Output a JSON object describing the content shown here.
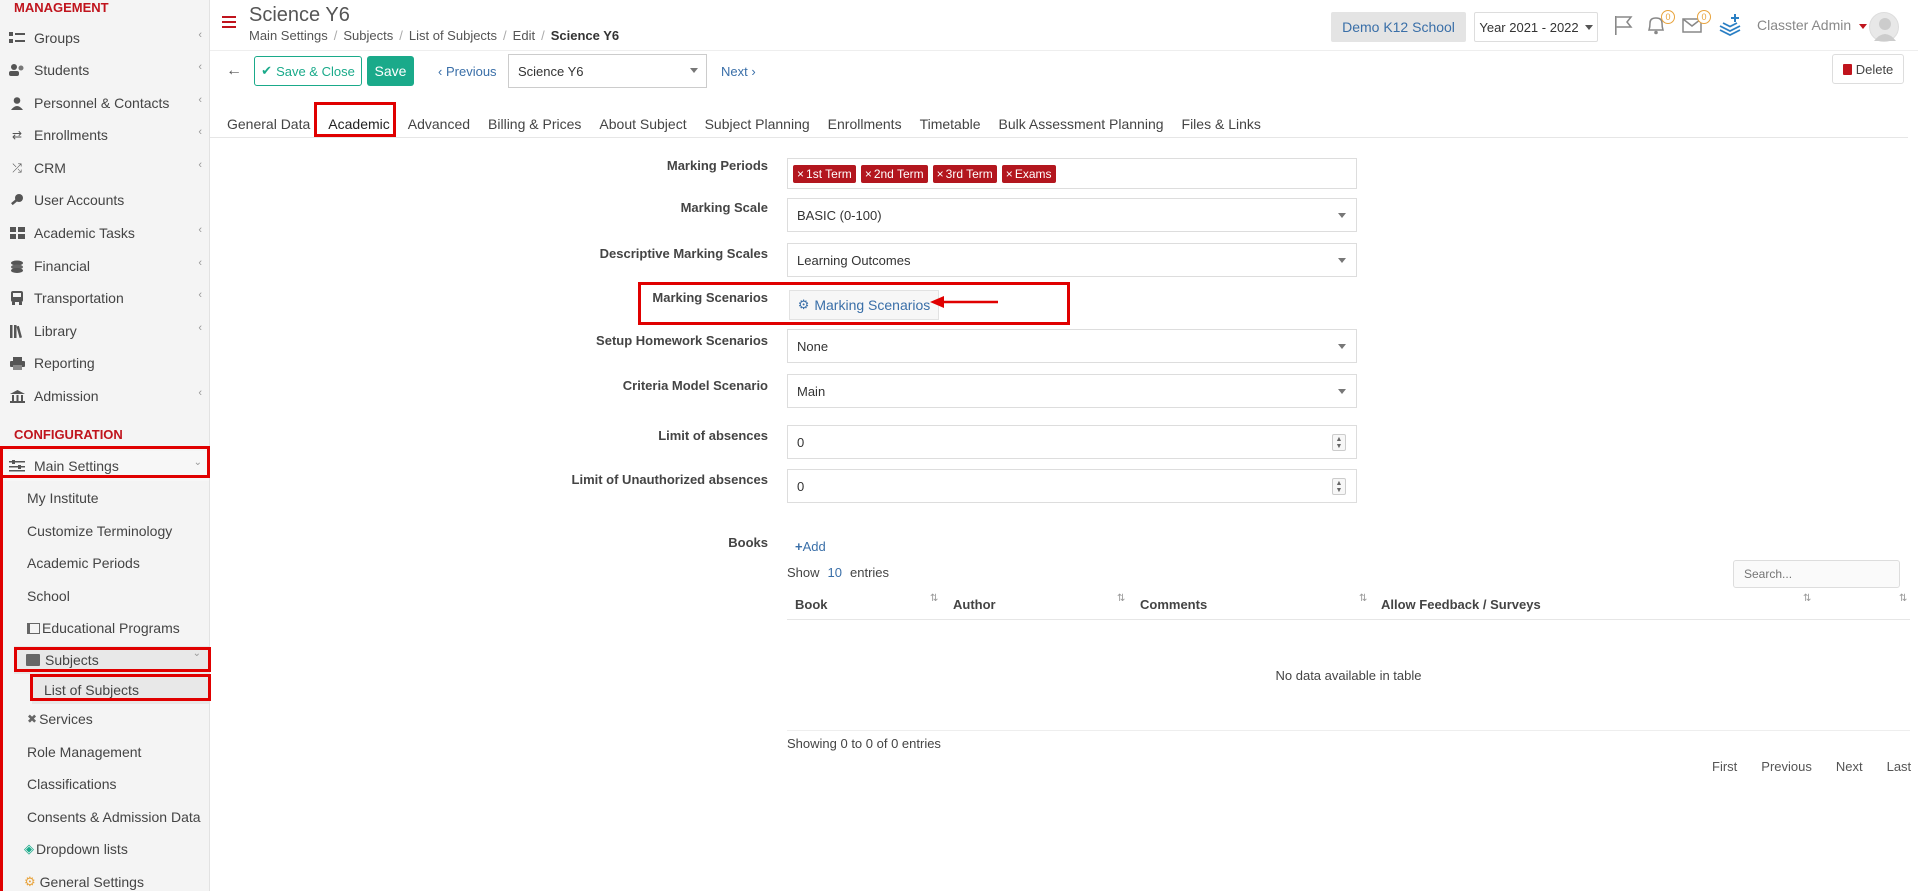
{
  "sidebar": {
    "management_heading": "MANAGEMENT",
    "configuration_heading": "CONFIGURATION",
    "management_items": [
      {
        "label": "Groups",
        "icon": "groups-icon"
      },
      {
        "label": "Students",
        "icon": "students-icon"
      },
      {
        "label": "Personnel & Contacts",
        "icon": "person-icon"
      },
      {
        "label": "Enrollments",
        "icon": "exchange-icon"
      },
      {
        "label": "CRM",
        "icon": "shuffle-icon"
      },
      {
        "label": "User Accounts",
        "icon": "key-icon"
      },
      {
        "label": "Academic Tasks",
        "icon": "grid-icon"
      },
      {
        "label": "Financial",
        "icon": "coins-icon"
      },
      {
        "label": "Transportation",
        "icon": "bus-icon"
      },
      {
        "label": "Library",
        "icon": "library-icon"
      },
      {
        "label": "Reporting",
        "icon": "printer-icon"
      },
      {
        "label": "Admission",
        "icon": "bank-icon"
      }
    ],
    "main_settings_label": "Main Settings",
    "sub_items": [
      "My Institute",
      "Customize Terminology",
      "Academic Periods",
      "School"
    ],
    "educational_programs_label": "Educational Programs",
    "subjects_label": "Subjects",
    "list_of_subjects_label": "List of Subjects",
    "services_label": "Services",
    "more_items": [
      "Role Management",
      "Classifications",
      "Consents & Admission Data"
    ],
    "dropdown_lists_label": "Dropdown lists",
    "general_settings_label": "General Settings"
  },
  "header": {
    "title": "Science Y6",
    "breadcrumb": [
      "Main Settings",
      "Subjects",
      "List of Subjects",
      "Edit",
      "Science Y6"
    ],
    "school": "Demo K12 School",
    "year": "Year 2021 - 2022",
    "notifications_count": "0",
    "messages_count": "0",
    "user": "Classter Admin"
  },
  "toolbar": {
    "save_close_label": "Save & Close",
    "save_label": "Save",
    "previous_label": "Previous",
    "subject_value": "Science Y6",
    "next_label": "Next",
    "delete_label": "Delete"
  },
  "tabs": [
    "General Data",
    "Academic",
    "Advanced",
    "Billing & Prices",
    "About Subject",
    "Subject Planning",
    "Enrollments",
    "Timetable",
    "Bulk Assessment Planning",
    "Files & Links"
  ],
  "active_tab": "Academic",
  "form": {
    "marking_periods_label": "Marking Periods",
    "marking_periods_tags": [
      "1st Term",
      "2nd Term",
      "3rd Term",
      "Exams"
    ],
    "marking_scale_label": "Marking Scale",
    "marking_scale_value": "BASIC (0-100)",
    "descriptive_label": "Descriptive Marking Scales",
    "descriptive_value": "Learning Outcomes",
    "marking_scenarios_label": "Marking Scenarios",
    "marking_scenarios_button": "Marking Scenarios",
    "homework_label": "Setup Homework Scenarios",
    "homework_value": "None",
    "criteria_label": "Criteria Model Scenario",
    "criteria_value": "Main",
    "absences_label": "Limit of absences",
    "absences_value": "0",
    "unauth_label": "Limit of Unauthorized absences",
    "unauth_value": "0"
  },
  "books": {
    "label": "Books",
    "add_label": "Add",
    "show_label": "Show",
    "show_count": "10",
    "entries_label": "entries",
    "search_placeholder": "Search...",
    "columns": [
      "Book",
      "Author",
      "Comments",
      "Allow Feedback / Surveys"
    ],
    "empty_text": "No data available in table",
    "showing_text": "Showing 0 to 0 of 0 entries",
    "pager": [
      "First",
      "Previous",
      "Next",
      "Last"
    ]
  },
  "colors": {
    "brand_red": "#c0141d",
    "teal": "#1aaa8a",
    "link_blue": "#3a6fa8",
    "highlight_red": "#e00000"
  }
}
